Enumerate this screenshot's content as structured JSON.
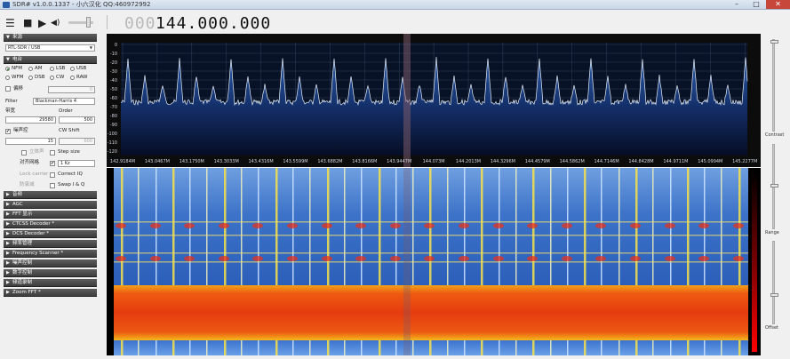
{
  "window": {
    "title": "SDR# v1.0.0.1337 - 小六汉化 QQ:460972992",
    "controls": {
      "minimize": "–",
      "maximize": "□",
      "close": "✕"
    }
  },
  "toolbar": {
    "frequency_dim": "000",
    "frequency": "144.000.000",
    "play_icon": "☰",
    "stop_icon": "■",
    "audio_icon": "◀)"
  },
  "sidebar": {
    "source": {
      "header": "来源",
      "device": "RTL-SDR / USB"
    },
    "radio": {
      "header": "电台",
      "modes": [
        "NFM",
        "AM",
        "LSB",
        "USB",
        "WFM",
        "DSB",
        "CW",
        "RAW"
      ],
      "selected_mode": "NFM",
      "shift_label": "偏移",
      "shift_value": "0",
      "filter_label": "Filter",
      "filter_value": "Blackman-Harris 4",
      "bandwidth_label": "带宽",
      "bandwidth_value": "29580",
      "order_label": "Order",
      "order_value": "500",
      "squelch_label": "噪声控",
      "cwshift_label": "CW Shift",
      "squelch_value": "15",
      "cwshift_value": "600",
      "fm_stereo_label": "立体声",
      "step_size_label": "Step size",
      "snap_label": "对齐网格",
      "snap_value": "1 Kz",
      "lock_carrier_label": "Lock carrier",
      "correct_iq_label": "Correct IQ",
      "antifade_label": "防衰减",
      "swap_iq_label": "Swap I & Q"
    },
    "sections": [
      "音频",
      "AGC",
      "FFT 显示",
      "CTCSS Decoder *",
      "DCS Decoder *",
      "频率管理",
      "Frequency Scanner *",
      "噪声控制",
      "数字控制",
      "频道录制",
      "Zoom FFT *"
    ]
  },
  "spectrum": {
    "y_ticks": [
      "0",
      "-10",
      "-20",
      "-30",
      "-40",
      "-50",
      "-60",
      "-70",
      "-80",
      "-90",
      "-100",
      "-110",
      "-120"
    ],
    "x_ticks": [
      "142.9184M",
      "143.0467M",
      "143.1750M",
      "143.3033M",
      "143.4316M",
      "143.5599M",
      "143.6882M",
      "143.8166M",
      "143.9447M",
      "144.073M",
      "144.2013M",
      "144.3296M",
      "144.4579M",
      "144.5862M",
      "144.7146M",
      "144.8428M",
      "144.9711M",
      "145.0994M",
      "145.2277M"
    ]
  },
  "right_panel": {
    "contrast_label": "Contrast",
    "range_label": "Range",
    "offset_label": "Offset"
  },
  "colors": {
    "accent": "#2a7d2a",
    "spectrum_bg": "#0b1a3a",
    "spectrum_trace": "#dfe9f5",
    "waterfall_hot": "#e83a0e"
  }
}
